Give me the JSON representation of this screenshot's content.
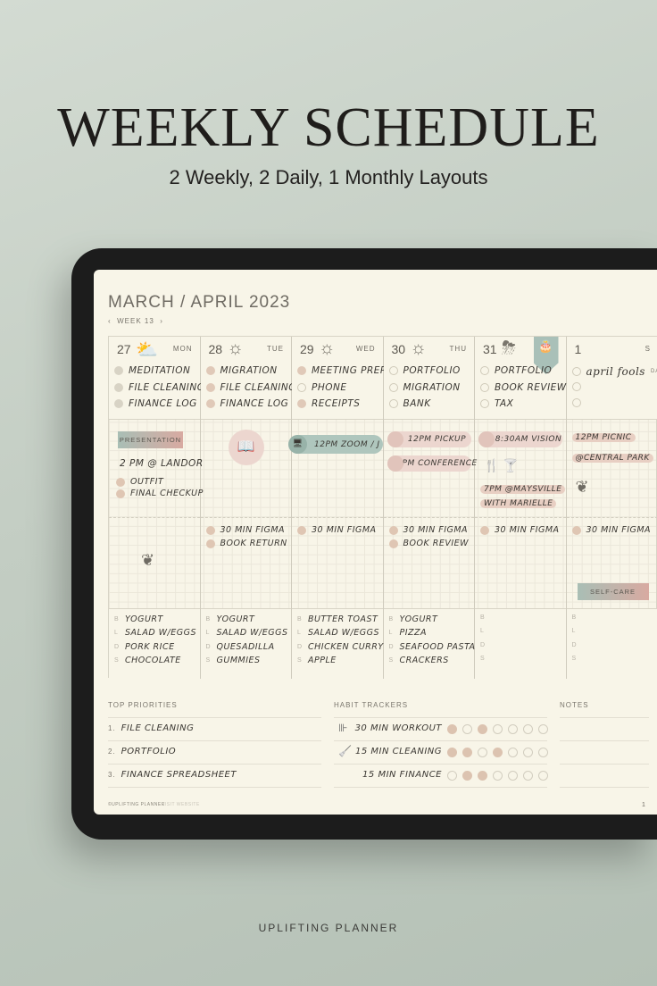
{
  "hero": {
    "title": "WEEKLY SCHEDULE",
    "subtitle": "2 Weekly, 2 Daily, 1 Monthly Layouts",
    "brand": "UPLIFTING PLANNER"
  },
  "planner": {
    "month": "MARCH / APRIL 2023",
    "week": {
      "prev": "‹",
      "label": "WEEK 13",
      "next": "›"
    },
    "days": [
      {
        "date": "27",
        "weekday": "MON",
        "weather": "partly-cloudy-icon",
        "weather_glyph": "⛅",
        "tasks": [
          {
            "text": "MEDITATION",
            "done": true
          },
          {
            "text": "FILE CLEANING",
            "done": true
          },
          {
            "text": "FINANCE LOG",
            "done": true
          }
        ],
        "events": [
          {
            "style": "tag",
            "text": "PRESENTATION"
          },
          {
            "style": "text",
            "text": "2 PM @ LANDOR"
          },
          {
            "style": "dot",
            "text": "OUTFIT"
          },
          {
            "style": "dot",
            "text": "FINAL CHECKUP"
          }
        ],
        "afternoon": [],
        "afternoon_icon": "leaf-icon",
        "meals": {
          "B": "YOGURT",
          "L": "SALAD W/EGGS",
          "D": "PORK RICE",
          "S": "CHOCOLATE"
        }
      },
      {
        "date": "28",
        "weekday": "TUE",
        "weather": "sun-icon",
        "weather_glyph": "☼",
        "tasks": [
          {
            "text": "MIGRATION",
            "done": true
          },
          {
            "text": "FILE CLEANING",
            "done": true
          },
          {
            "text": "FINANCE LOG",
            "done": true
          }
        ],
        "events": [
          {
            "style": "icon",
            "icon": "book-icon",
            "glyph": "📖"
          }
        ],
        "afternoon": [
          "30 MIN FIGMA",
          "BOOK RETURN"
        ],
        "meals": {
          "B": "YOGURT",
          "L": "SALAD W/EGGS",
          "D": "QUESADILLA",
          "S": "GUMMIES"
        }
      },
      {
        "date": "29",
        "weekday": "WED",
        "weather": "sun-icon",
        "weather_glyph": "☼",
        "tasks": [
          {
            "text": "MEETING PREP",
            "done": true
          },
          {
            "text": "PHONE",
            "done": false
          },
          {
            "text": "RECEIPTS",
            "done": true
          }
        ],
        "events": [
          {
            "style": "gpill",
            "text": "12PM ZOOM / J",
            "icon": "monitor-icon"
          }
        ],
        "afternoon": [
          "30 MIN FIGMA"
        ],
        "meals": {
          "B": "BUTTER TOAST",
          "L": "SALAD W/EGGS",
          "D": "CHICKEN CURRY",
          "S": "APPLE"
        }
      },
      {
        "date": "30",
        "weekday": "THU",
        "weather": "sun-icon",
        "weather_glyph": "☼",
        "tasks": [
          {
            "text": "PORTFOLIO",
            "done": false
          },
          {
            "text": "MIGRATION",
            "done": false
          },
          {
            "text": "BANK",
            "done": false
          }
        ],
        "events": [
          {
            "style": "pill",
            "text": "12PM PICKUP"
          },
          {
            "style": "pill",
            "text": "2PM CONFERENCE"
          }
        ],
        "afternoon": [
          "30 MIN FIGMA",
          "BOOK REVIEW"
        ],
        "meals": {
          "B": "YOGURT",
          "L": "PIZZA",
          "D": "SEAFOOD PASTA",
          "S": "CRACKERS"
        }
      },
      {
        "date": "31",
        "weekday": "",
        "weather": "rain-cloud-icon",
        "weather_glyph": "⛈",
        "bookmark": "birthday-cake-icon",
        "tasks": [
          {
            "text": "PORTFOLIO",
            "done": false
          },
          {
            "text": "BOOK REVIEW",
            "done": false
          },
          {
            "text": "TAX",
            "done": false
          }
        ],
        "events": [
          {
            "style": "pill",
            "text": "8:30AM VISION"
          },
          {
            "style": "icons",
            "icons": [
              "cutlery-icon",
              "drink-icon"
            ],
            "glyph": "🍴 🍸"
          },
          {
            "style": "hl",
            "text": "7PM @MAYSVILLE"
          },
          {
            "style": "hl",
            "text": "WITH MARIELLE"
          }
        ],
        "afternoon": [
          "30 MIN FIGMA"
        ],
        "meals": {
          "B": "",
          "L": "",
          "D": "",
          "S": ""
        }
      },
      {
        "date": "1",
        "weekday": "S",
        "weather": "",
        "tasks": [
          {
            "text": "april fools",
            "sub": "DAY",
            "done": false
          },
          {
            "text": "",
            "done": false
          },
          {
            "text": "",
            "done": false
          }
        ],
        "events": [
          {
            "style": "hl",
            "text": "12PM PICNIC"
          },
          {
            "style": "hl",
            "text": "@CENTRAL PARK"
          },
          {
            "style": "leaf",
            "icon": "leaf-icon"
          }
        ],
        "afternoon": [
          "30 MIN FIGMA"
        ],
        "afternoon_tag": "SELF-CARE",
        "meals": {
          "B": "",
          "L": "",
          "D": "",
          "S": ""
        }
      }
    ],
    "priorities": {
      "label": "TOP PRIORITIES",
      "items": [
        "FILE CLEANING",
        "PORTFOLIO",
        "FINANCE SPREADSHEET"
      ]
    },
    "habits": {
      "label": "HABIT TRACKERS",
      "items": [
        {
          "icon": "dumbbell-icon",
          "glyph": "⊪",
          "text": "30 MIN WORKOUT",
          "days": [
            1,
            0,
            1,
            0,
            0,
            0,
            0
          ]
        },
        {
          "icon": "broom-icon",
          "glyph": "🧹",
          "text": "15 MIN CLEANING",
          "days": [
            1,
            1,
            0,
            1,
            0,
            0,
            0
          ]
        },
        {
          "icon": "",
          "glyph": "",
          "text": "15 MIN FINANCE",
          "days": [
            0,
            1,
            1,
            0,
            0,
            0,
            0
          ]
        }
      ]
    },
    "notes": {
      "label": "NOTES"
    },
    "footer": {
      "brand": "©UPLIFTING PLANNER",
      "link": "VISIT WEBSITE",
      "page": "1"
    }
  },
  "colors": {
    "background": "#c3cdc3",
    "paper": "#f8f5e8",
    "pink": "#ecd6cf",
    "sage": "#afc6bd",
    "dot": "#dfc6b3"
  }
}
